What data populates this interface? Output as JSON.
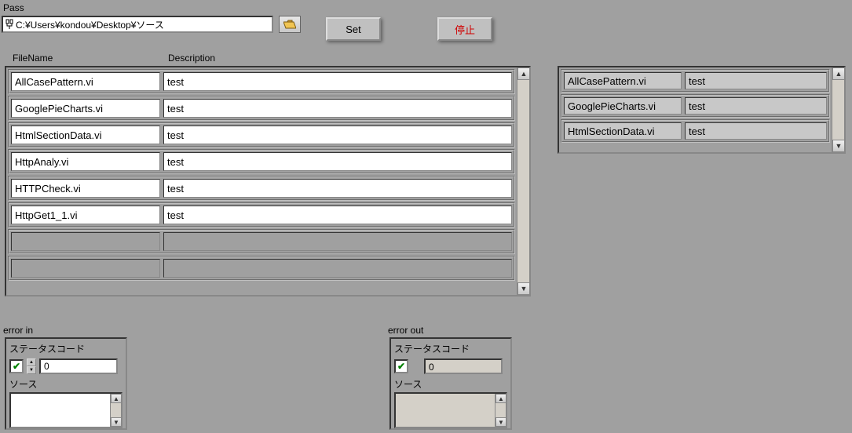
{
  "pass_label": "Pass",
  "path_value": "C:¥Users¥kondou¥Desktop¥ソース",
  "set_btn": "Set",
  "stop_btn": "停止",
  "columns": {
    "filename": "FileName",
    "description": "Description"
  },
  "left_rows": [
    {
      "filename": "AllCasePattern.vi",
      "description": "test"
    },
    {
      "filename": "GooglePieCharts.vi",
      "description": "test"
    },
    {
      "filename": "HtmlSectionData.vi",
      "description": "test"
    },
    {
      "filename": "HttpAnaly.vi",
      "description": "test"
    },
    {
      "filename": "HTTPCheck.vi",
      "description": "test"
    },
    {
      "filename": "HttpGet1_1.vi",
      "description": "test"
    }
  ],
  "right_rows": [
    {
      "filename": "AllCasePattern.vi",
      "description": "test"
    },
    {
      "filename": "GooglePieCharts.vi",
      "description": "test"
    },
    {
      "filename": "HtmlSectionData.vi",
      "description": "test"
    }
  ],
  "error_in": {
    "title": "error in",
    "status_code_label": "ステータスコード",
    "code_value": "0",
    "source_label": "ソース",
    "source_value": ""
  },
  "error_out": {
    "title": "error out",
    "status_code_label": "ステータスコード",
    "code_value": "0",
    "source_label": "ソース",
    "source_value": ""
  }
}
